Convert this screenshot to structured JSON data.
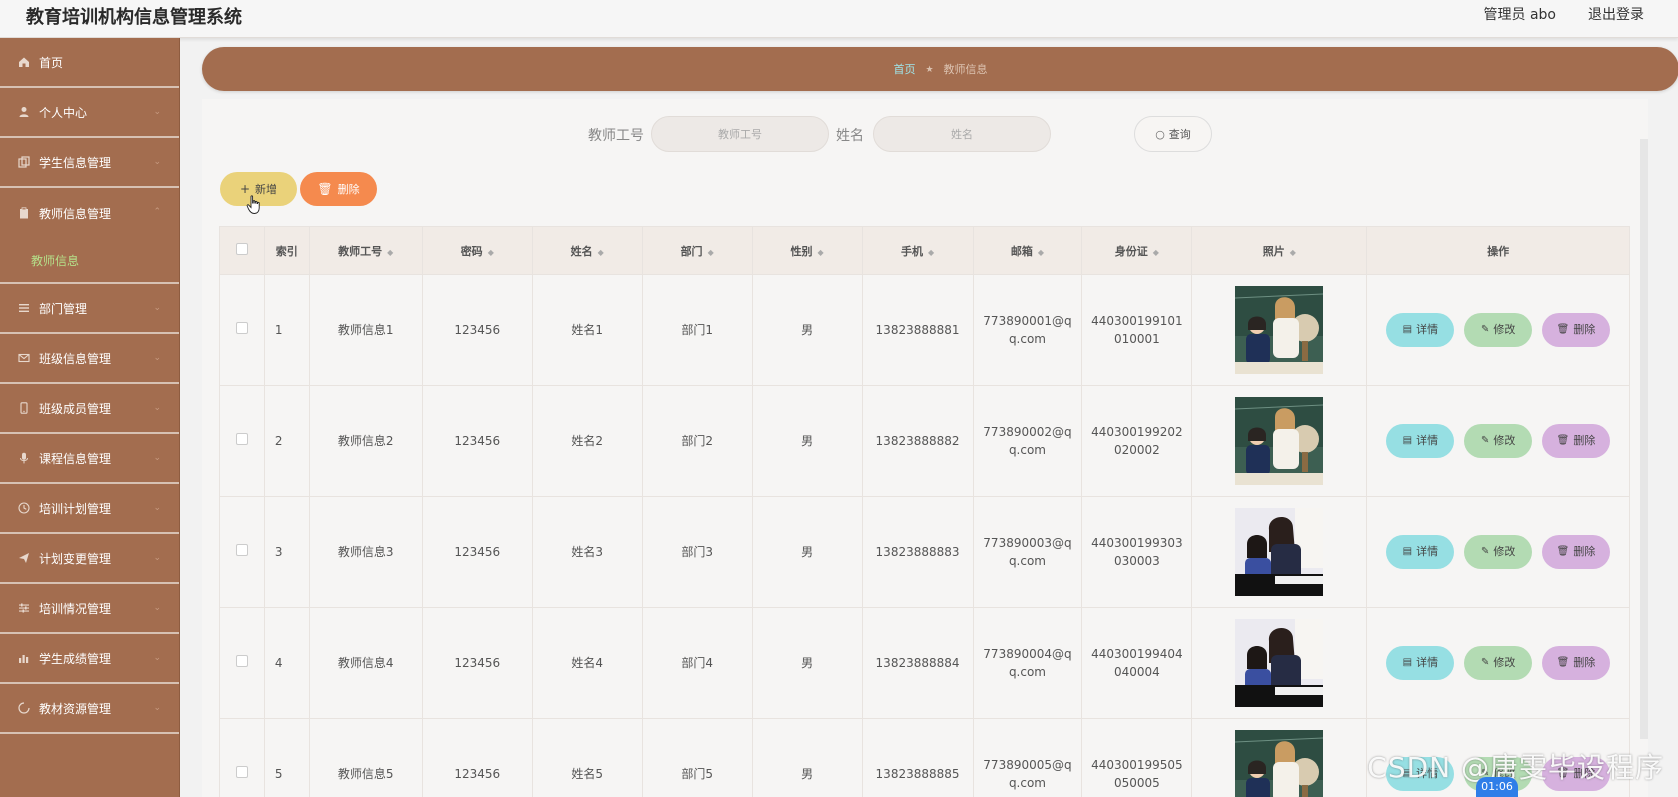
{
  "header": {
    "title": "教育培训机构信息管理系统",
    "user_label": "管理员 abo",
    "logout_label": "退出登录"
  },
  "sidebar": {
    "items": [
      {
        "label": "首页",
        "icon": "home-icon"
      },
      {
        "label": "个人中心",
        "icon": "user-icon"
      },
      {
        "label": "学生信息管理",
        "icon": "copy-icon"
      },
      {
        "label": "教师信息管理",
        "icon": "clipboard-icon"
      },
      {
        "label": "部门管理",
        "icon": "list-icon"
      },
      {
        "label": "班级信息管理",
        "icon": "mail-icon"
      },
      {
        "label": "班级成员管理",
        "icon": "mobile-icon"
      },
      {
        "label": "课程信息管理",
        "icon": "mic-icon"
      },
      {
        "label": "培训计划管理",
        "icon": "clock-icon"
      },
      {
        "label": "计划变更管理",
        "icon": "send-icon"
      },
      {
        "label": "培训情况管理",
        "icon": "sliders-icon"
      },
      {
        "label": "学生成绩管理",
        "icon": "bar-chart-icon"
      },
      {
        "label": "教材资源管理",
        "icon": "loading-icon"
      }
    ],
    "active_sub": "教师信息"
  },
  "breadcrumb": {
    "home": "首页",
    "current": "教师信息"
  },
  "search": {
    "teacher_id_label": "教师工号",
    "teacher_id_placeholder": "教师工号",
    "name_label": "姓名",
    "name_placeholder": "姓名",
    "query_label": "查询"
  },
  "toolbar": {
    "add_label": "新增",
    "delete_label": "删除"
  },
  "table": {
    "headers": {
      "index": "索引",
      "teacher_id": "教师工号",
      "password": "密码",
      "name": "姓名",
      "dept": "部门",
      "gender": "性别",
      "phone": "手机",
      "email": "邮箱",
      "id_card": "身份证",
      "photo": "照片",
      "ops": "操作"
    },
    "ops": {
      "detail": "详情",
      "edit": "修改",
      "delete": "删除"
    },
    "rows": [
      {
        "index": "1",
        "teacher_id": "教师信息1",
        "password": "123456",
        "name": "姓名1",
        "dept": "部门1",
        "gender": "男",
        "phone": "13823888881",
        "email_a": "773890001@q",
        "email_b": "q.com",
        "id_a": "440300199101",
        "id_b": "010001",
        "photo": "teacher-with-globe"
      },
      {
        "index": "2",
        "teacher_id": "教师信息2",
        "password": "123456",
        "name": "姓名2",
        "dept": "部门2",
        "gender": "男",
        "phone": "13823888882",
        "email_a": "773890002@q",
        "email_b": "q.com",
        "id_a": "440300199202",
        "id_b": "020002",
        "photo": "teacher-with-globe"
      },
      {
        "index": "3",
        "teacher_id": "教师信息3",
        "password": "123456",
        "name": "姓名3",
        "dept": "部门3",
        "gender": "男",
        "phone": "13823888883",
        "email_a": "773890003@q",
        "email_b": "q.com",
        "id_a": "440300199303",
        "id_b": "030003",
        "photo": "piano-lesson"
      },
      {
        "index": "4",
        "teacher_id": "教师信息4",
        "password": "123456",
        "name": "姓名4",
        "dept": "部门4",
        "gender": "男",
        "phone": "13823888884",
        "email_a": "773890004@q",
        "email_b": "q.com",
        "id_a": "440300199404",
        "id_b": "040004",
        "photo": "piano-lesson"
      },
      {
        "index": "5",
        "teacher_id": "教师信息5",
        "password": "123456",
        "name": "姓名5",
        "dept": "部门5",
        "gender": "男",
        "phone": "13823888885",
        "email_a": "773890005@q",
        "email_b": "q.com",
        "id_a": "440300199505",
        "id_b": "050005",
        "photo": "teacher-with-globe"
      }
    ]
  },
  "overlay": {
    "watermark": "CSDN @唐雯毕设程序",
    "timer": "01:06"
  },
  "colors": {
    "sidebar": "#a36d4f",
    "accent_add": "#ead27a",
    "accent_delete": "#f58a4e"
  }
}
